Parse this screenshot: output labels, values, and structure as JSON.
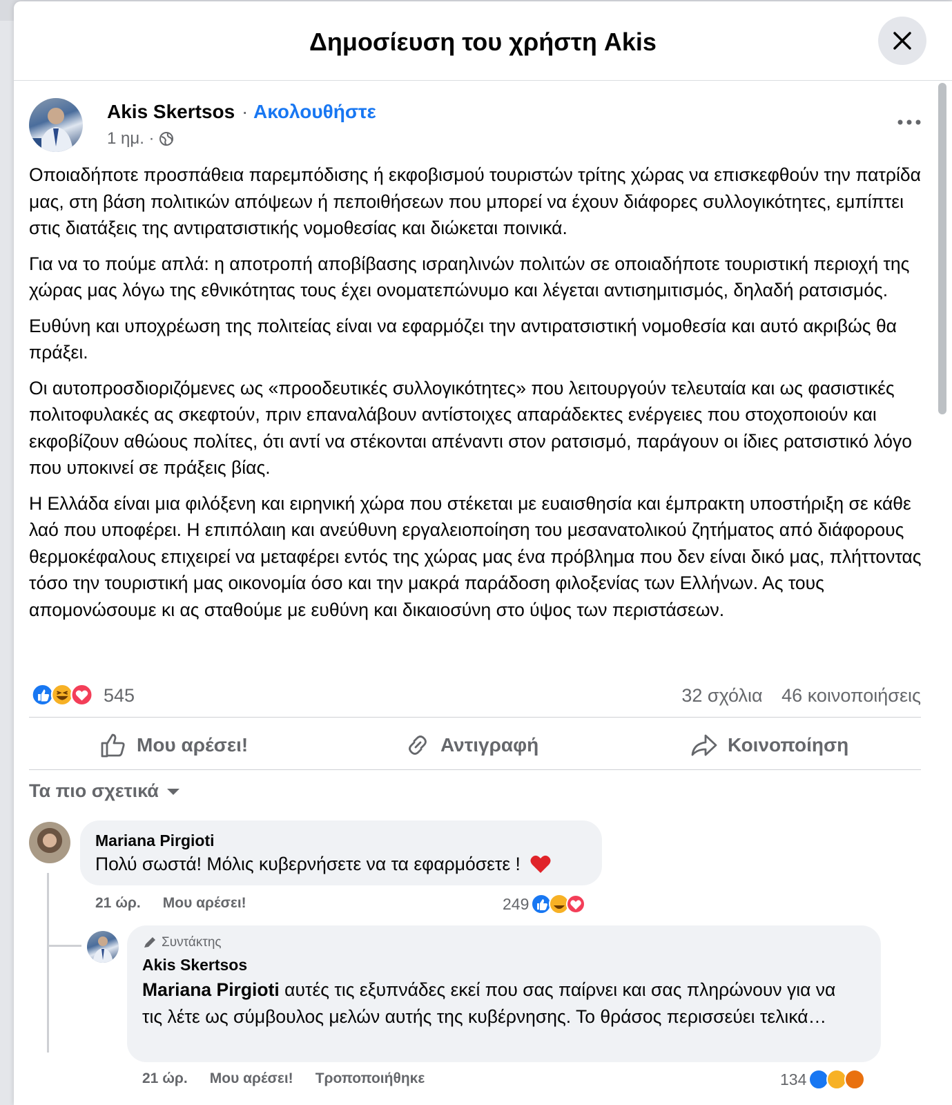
{
  "modal": {
    "title": "Δημοσίευση του χρήστη Akis"
  },
  "post": {
    "author": "Akis Skertsos",
    "separator": "·",
    "follow": "Ακολουθήστε",
    "time": "1 ημ. ·",
    "paragraphs": [
      "Οποιαδήποτε προσπάθεια παρεμπόδισης ή εκφοβισμού τουριστών τρίτης χώρας να επισκεφθούν την πατρίδα μας, στη βάση πολιτικών απόψεων ή πεποιθήσεων που μπορεί να έχουν διάφορες συλλογικότητες, εμπίπτει στις διατάξεις της αντιρατσιστικής νομοθεσίας και διώκεται ποινικά.",
      "Για να το πούμε απλά: η αποτροπή αποβίβασης ισραηλινών πολιτών σε οποιαδήποτε τουριστική περιοχή της χώρας μας λόγω της εθνικότητας τους έχει ονοματεπώνυμο και λέγεται αντισημιτισμός, δηλαδή ρατσισμός.",
      "Ευθύνη και υποχρέωση της πολιτείας είναι να εφαρμόζει την αντιρατσιστική νομοθεσία και αυτό ακριβώς θα πράξει.",
      "Οι αυτοπροσδιοριζόμενες ως «προοδευτικές συλλογικότητες» που λειτουργούν τελευταία και ως φασιστικές πολιτοφυλακές ας σκεφτούν, πριν επαναλάβουν αντίστοιχες απαράδεκτες ενέργειες που στοχοποιούν και εκφοβίζουν αθώους πολίτες, ότι αντί να στέκονται απέναντι στον ρατσισμό, παράγουν οι ίδιες ρατσιστικό λόγο που υποκινεί σε πράξεις βίας.",
      "Η Ελλάδα είναι μια φιλόξενη και ειρηνική χώρα που στέκεται με ευαισθησία και έμπρακτη υποστήριξη σε κάθε λαό που υποφέρει. Η επιπόλαιη και ανεύθυνη εργαλειοποίηση του μεσανατολικού ζητήματος από διάφορους θερμοκέφαλους επιχειρεί να μεταφέρει εντός της χώρας μας ένα πρόβλημα που δεν είναι δικό μας, πλήττοντας τόσο την τουριστική μας οικονομία όσο και την μακρά παράδοση φιλοξενίας των Ελλήνων. Ας τους απομονώσουμε κι ας σταθούμε με ευθύνη και δικαιοσύνη στο ύψος των περιστάσεων."
    ],
    "reaction_count": "545",
    "comments": "32 σχόλια",
    "shares": "46 κοινοποιήσεις"
  },
  "actions": {
    "like": "Μου αρέσει!",
    "copy": "Αντιγραφή",
    "share": "Κοινοποίηση"
  },
  "sort": {
    "label": "Τα πιο σχετικά"
  },
  "comments": [
    {
      "author": "Mariana Pirgioti",
      "text": "Πολύ σωστά! Μόλις κυβερνήσετε να τα εφαρμόσετε !",
      "time": "21 ώρ.",
      "like": "Μου αρέσει!",
      "reaction_count": "249"
    },
    {
      "badge": "Συντάκτης",
      "author": "Akis Skertsos",
      "mention": "Mariana Pirgioti",
      "text": "αυτές τις εξυπνάδες εκεί που σας παίρνει και σας πληρώνουν για να τις λέτε ως σύμβουλος μελών αυτής της κυβέρνησης. Το θράσος περισσεύει τελικά…",
      "time": "21 ώρ.",
      "like": "Μου αρέσει!",
      "edited": "Τροποποιήθηκε",
      "reaction_count": "134"
    }
  ],
  "colors": {
    "accent": "#1877f2",
    "secondary_text": "#65676b",
    "bubble": "#f0f2f5",
    "love": "#f33e58",
    "haha": "#f7b125"
  }
}
